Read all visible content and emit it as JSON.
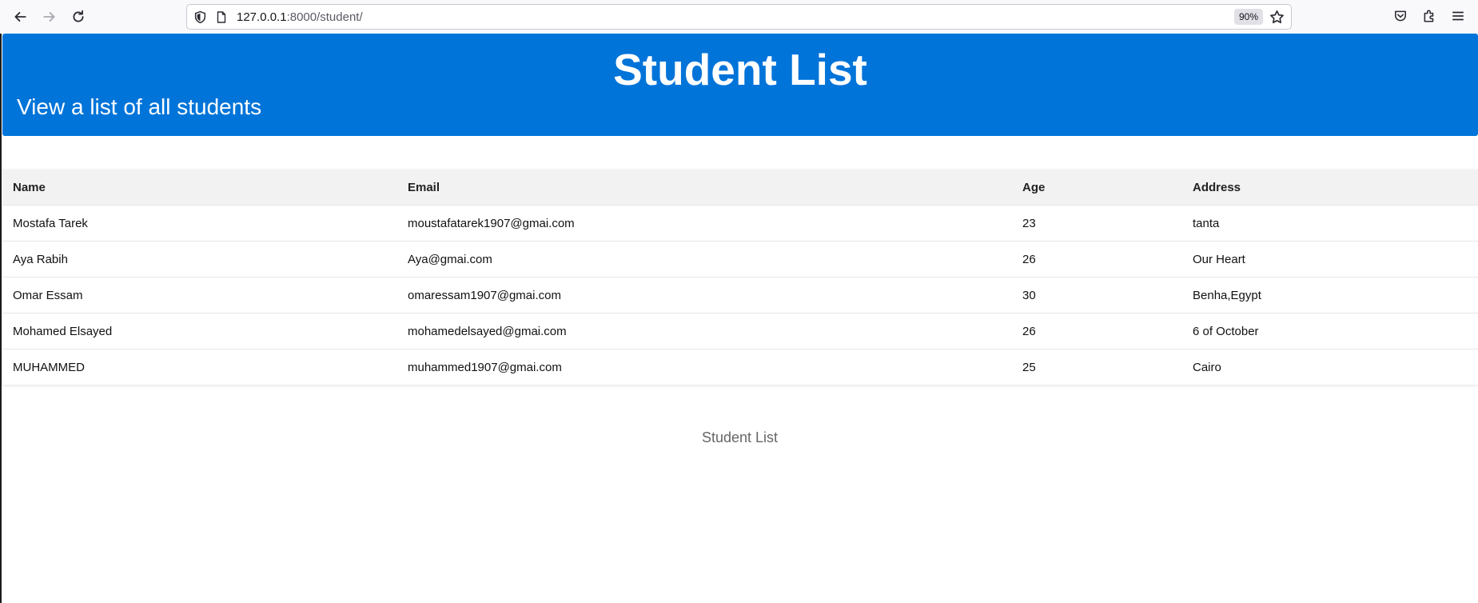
{
  "browser": {
    "url_host": "127.0.0.1",
    "url_rest": ":8000/student/",
    "zoom": "90%"
  },
  "icons": {
    "back": "back-arrow-icon",
    "forward": "forward-arrow-icon",
    "reload": "reload-icon",
    "shield": "shield-icon",
    "page": "page-icon",
    "star": "star-icon",
    "pocket": "pocket-icon",
    "extensions": "extensions-icon",
    "menu": "hamburger-menu-icon"
  },
  "colors": {
    "header_bg": "#0074d9",
    "header_text": "#ffffff"
  },
  "header": {
    "title": "Student List",
    "subtitle": "View a list of all students"
  },
  "table": {
    "columns": [
      "Name",
      "Email",
      "Age",
      "Address"
    ],
    "rows": [
      [
        "Mostafa Tarek",
        "moustafatarek1907@gmai.com",
        "23",
        "tanta"
      ],
      [
        "Aya Rabih",
        "Aya@gmai.com",
        "26",
        "Our Heart"
      ],
      [
        "Omar Essam",
        "omaressam1907@gmai.com",
        "30",
        "Benha,Egypt"
      ],
      [
        "Mohamed Elsayed",
        "mohamedelsayed@gmai.com",
        "26",
        "6 of October"
      ],
      [
        "MUHAMMED",
        "muhammed1907@gmai.com",
        "25",
        "Cairo"
      ]
    ]
  },
  "footer": {
    "text": "Student List"
  }
}
